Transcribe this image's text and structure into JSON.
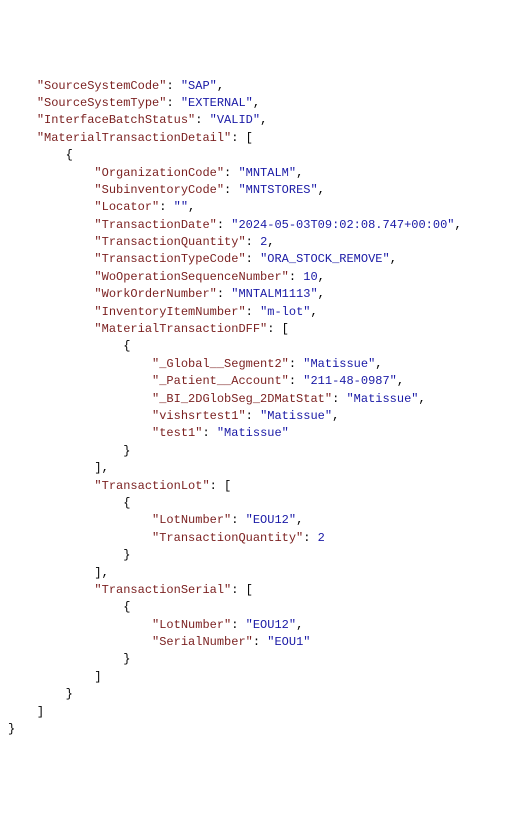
{
  "lines": [
    {
      "indent": "    ",
      "key": "SourceSystemCode",
      "sep": ": ",
      "valType": "str",
      "val": "SAP",
      "trail": ","
    },
    {
      "indent": "    ",
      "key": "SourceSystemType",
      "sep": ": ",
      "valType": "str",
      "val": "EXTERNAL",
      "trail": ","
    },
    {
      "indent": "    ",
      "key": "InterfaceBatchStatus",
      "sep": ": ",
      "valType": "str",
      "val": "VALID",
      "trail": ","
    },
    {
      "indent": "    ",
      "key": "MaterialTransactionDetail",
      "sep": ": ",
      "valType": "punct",
      "val": "[",
      "trail": ""
    },
    {
      "indent": "        ",
      "valType": "punct",
      "val": "{",
      "trail": ""
    },
    {
      "indent": "            ",
      "key": "OrganizationCode",
      "sep": ": ",
      "valType": "str",
      "val": "MNTALM",
      "trail": ","
    },
    {
      "indent": "            ",
      "key": "SubinventoryCode",
      "sep": ": ",
      "valType": "str",
      "val": "MNTSTORES",
      "trail": ","
    },
    {
      "indent": "            ",
      "key": "Locator",
      "sep": ": ",
      "valType": "str",
      "val": "",
      "trail": ","
    },
    {
      "indent": "            ",
      "key": "TransactionDate",
      "sep": ": ",
      "valType": "str",
      "val": "2024-05-03T09:02:08.747+00:00",
      "trail": ","
    },
    {
      "indent": "            ",
      "key": "TransactionQuantity",
      "sep": ": ",
      "valType": "num",
      "val": "2",
      "trail": ","
    },
    {
      "indent": "            ",
      "key": "TransactionTypeCode",
      "sep": ": ",
      "valType": "str",
      "val": "ORA_STOCK_REMOVE",
      "trail": ","
    },
    {
      "indent": "            ",
      "key": "WoOperationSequenceNumber",
      "sep": ": ",
      "valType": "num",
      "val": "10",
      "trail": ","
    },
    {
      "indent": "            ",
      "key": "WorkOrderNumber",
      "sep": ": ",
      "valType": "str",
      "val": "MNTALM1113",
      "trail": ","
    },
    {
      "indent": "            ",
      "key": "InventoryItemNumber",
      "sep": ": ",
      "valType": "str",
      "val": "m-lot",
      "trail": ","
    },
    {
      "indent": "            ",
      "key": "MaterialTransactionDFF",
      "sep": ": ",
      "valType": "punct",
      "val": "[",
      "trail": ""
    },
    {
      "indent": "                ",
      "valType": "punct",
      "val": "{",
      "trail": ""
    },
    {
      "indent": "                    ",
      "key": "_Global__Segment2",
      "sep": ": ",
      "valType": "str",
      "val": "Matissue",
      "trail": ","
    },
    {
      "indent": "                    ",
      "key": "_Patient__Account",
      "sep": ": ",
      "valType": "str",
      "val": "211-48-0987",
      "trail": ","
    },
    {
      "indent": "                    ",
      "key": "_BI_2DGlobSeg_2DMatStat",
      "sep": ": ",
      "valType": "str",
      "val": "Matissue",
      "trail": ","
    },
    {
      "indent": "                    ",
      "key": "vishsrtest1",
      "sep": ": ",
      "valType": "str",
      "val": "Matissue",
      "trail": ","
    },
    {
      "indent": "                    ",
      "key": "test1",
      "sep": ": ",
      "valType": "str",
      "val": "Matissue",
      "trail": ""
    },
    {
      "indent": "                ",
      "valType": "punct",
      "val": "}",
      "trail": ""
    },
    {
      "indent": "            ",
      "valType": "punct",
      "val": "],",
      "trail": ""
    },
    {
      "indent": "            ",
      "key": "TransactionLot",
      "sep": ": ",
      "valType": "punct",
      "val": "[",
      "trail": ""
    },
    {
      "indent": "                ",
      "valType": "punct",
      "val": "{",
      "trail": ""
    },
    {
      "indent": "                    ",
      "key": "LotNumber",
      "sep": ": ",
      "valType": "str",
      "val": "EOU12",
      "trail": ","
    },
    {
      "indent": "                    ",
      "key": "TransactionQuantity",
      "sep": ": ",
      "valType": "num",
      "val": "2",
      "trail": ""
    },
    {
      "indent": "                ",
      "valType": "punct",
      "val": "}",
      "trail": ""
    },
    {
      "indent": "            ",
      "valType": "punct",
      "val": "],",
      "trail": ""
    },
    {
      "indent": "            ",
      "key": "TransactionSerial",
      "sep": ": ",
      "valType": "punct",
      "val": "[",
      "trail": ""
    },
    {
      "indent": "                ",
      "valType": "punct",
      "val": "{",
      "trail": ""
    },
    {
      "indent": "                    ",
      "key": "LotNumber",
      "sep": ": ",
      "valType": "str",
      "val": "EOU12",
      "trail": ","
    },
    {
      "indent": "                    ",
      "key": "SerialNumber",
      "sep": ": ",
      "valType": "str",
      "val": "EOU1",
      "trail": ""
    },
    {
      "indent": "                ",
      "valType": "punct",
      "val": "}",
      "trail": ""
    },
    {
      "indent": "            ",
      "valType": "punct",
      "val": "]",
      "trail": ""
    },
    {
      "indent": "        ",
      "valType": "punct",
      "val": "}",
      "trail": ""
    },
    {
      "indent": "    ",
      "valType": "punct",
      "val": "]",
      "trail": ""
    },
    {
      "indent": "",
      "valType": "punct",
      "val": "}",
      "trail": ""
    }
  ]
}
